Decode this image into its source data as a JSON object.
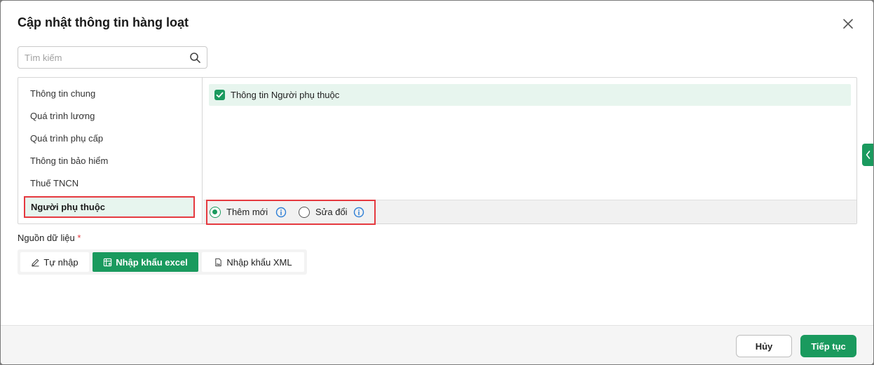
{
  "dialog": {
    "title": "Cập nhật thông tin hàng loạt"
  },
  "search": {
    "placeholder": "Tìm kiếm",
    "value": ""
  },
  "sidebar": {
    "items": [
      {
        "label": "Thông tin chung"
      },
      {
        "label": "Quá trình lương"
      },
      {
        "label": "Quá trình phụ cấp"
      },
      {
        "label": "Thông tin bảo hiểm"
      },
      {
        "label": "Thuế TNCN"
      },
      {
        "label": "Người phụ thuộc"
      }
    ],
    "active_index": 5
  },
  "content": {
    "checkbox_label": "Thông tin Người phụ thuộc",
    "checkbox_checked": true
  },
  "mode": {
    "options": [
      {
        "label": "Thêm mới",
        "checked": true
      },
      {
        "label": "Sửa đổi",
        "checked": false
      }
    ]
  },
  "source": {
    "label": "Nguồn dữ liệu",
    "required_mark": "*",
    "options": [
      {
        "label": "Tự nhập",
        "icon": "edit-icon",
        "active": false
      },
      {
        "label": "Nhập khẩu excel",
        "icon": "excel-icon",
        "active": true
      },
      {
        "label": "Nhập khẩu XML",
        "icon": "xml-file-icon",
        "active": false
      }
    ]
  },
  "footer": {
    "cancel_label": "Hủy",
    "next_label": "Tiếp tục"
  },
  "colors": {
    "accent": "#1a9a5e",
    "highlight_border": "#e5393f",
    "selected_bg": "#e7f5ee",
    "info": "#2f7fd6"
  }
}
